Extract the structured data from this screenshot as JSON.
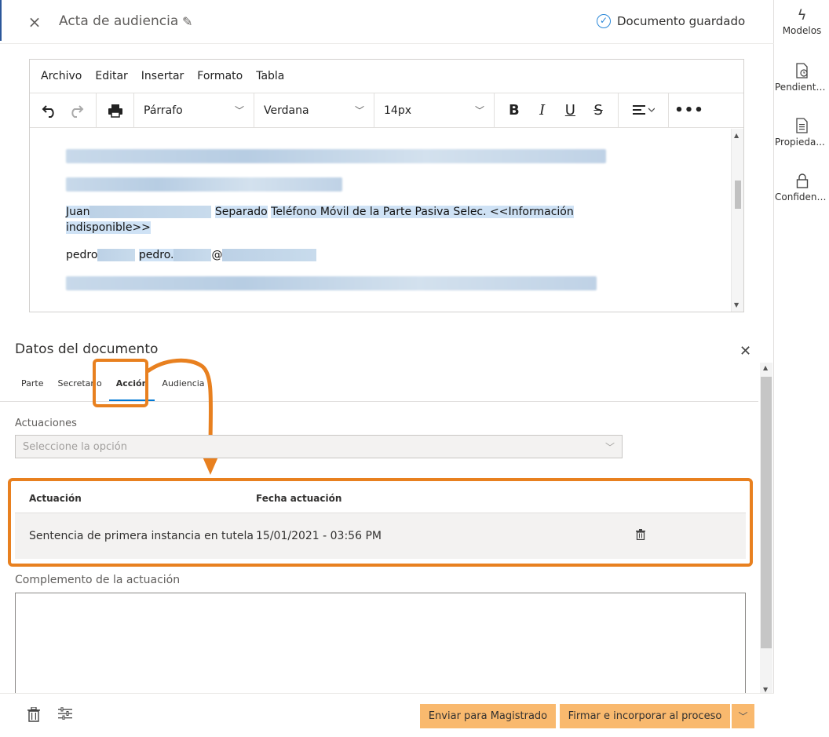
{
  "header": {
    "close_icon": "×",
    "title": "Acta de audiencia",
    "edit_icon": "✎",
    "saved_status": "Documento guardado"
  },
  "editor": {
    "menu": [
      "Archivo",
      "Editar",
      "Insertar",
      "Formato",
      "Tabla"
    ],
    "block_format": "Párrafo",
    "font_family": "Verdana",
    "font_size": "14px",
    "lines": {
      "name_first": "Juan",
      "separator_word": "Separado",
      "phone_text": "Teléfono Móvil de la Parte Pasiva Selec. <<Información",
      "phone_text_2": "indisponible>>",
      "email_name": "pedro",
      "email_name2": "pedro.",
      "email_at": "@"
    }
  },
  "panel": {
    "title": "Datos del documento",
    "tabs": [
      "Parte",
      "Secretario",
      "Acción",
      "Audiencia"
    ],
    "active_tab": "Acción",
    "actuaciones_label": "Actuaciones",
    "actuaciones_placeholder": "Seleccione la opción",
    "table": {
      "headers": [
        "Actuación",
        "Fecha actuación"
      ],
      "rows": [
        {
          "actuacion": "Sentencia de primera instancia en tutela",
          "fecha": "15/01/2021 - 03:56 PM"
        }
      ]
    },
    "complemento_label": "Complemento de la actuación"
  },
  "footer": {
    "send_label": "Enviar para Magistrado",
    "sign_label": "Firmar e incorporar al proceso"
  },
  "rail": {
    "items": [
      "Modelos",
      "Pendiente...",
      "Propieda...",
      "Confidenc..."
    ]
  },
  "colors": {
    "accent": "#0078d4",
    "highlight": "#e8801f",
    "button": "#f9b96e"
  }
}
